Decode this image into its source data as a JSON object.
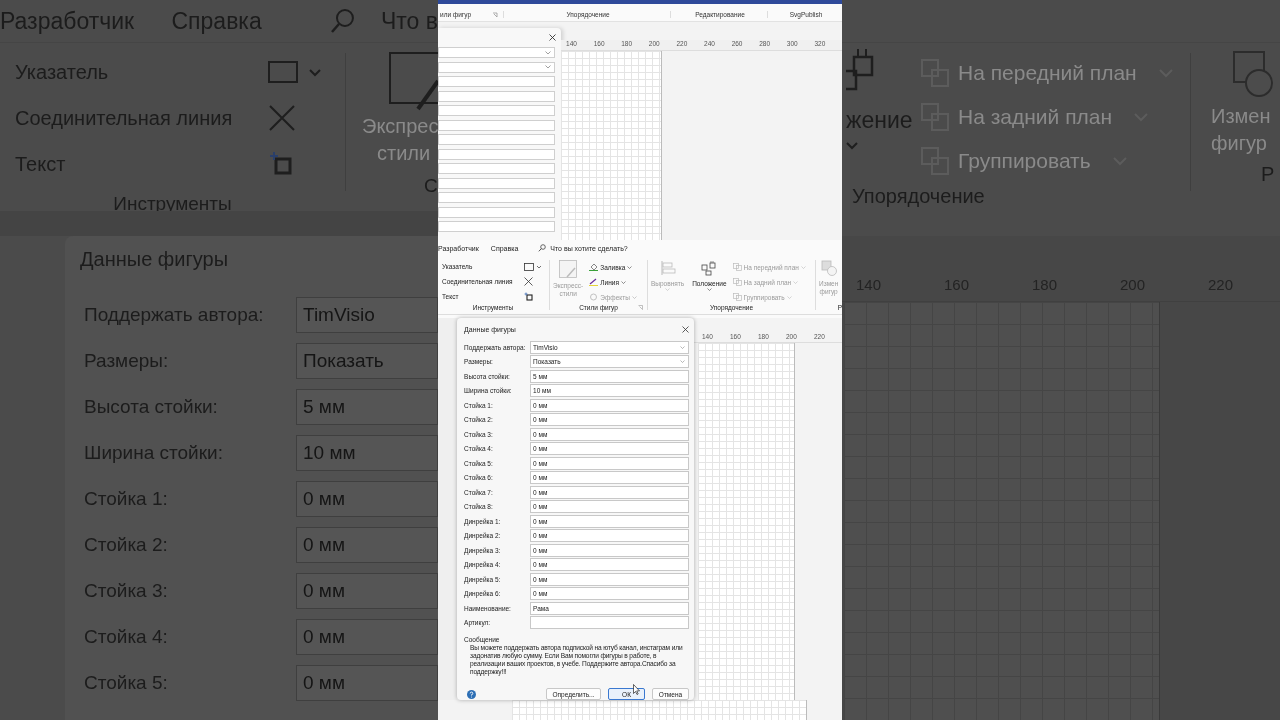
{
  "left_backdrop": {
    "tabs": [
      {
        "label": "Разработчик"
      },
      {
        "label": "Справка"
      }
    ],
    "search_text": "Что в",
    "tools": [
      {
        "label": "Указатель"
      },
      {
        "label": "Соединительная линия"
      },
      {
        "label": "Текст"
      }
    ],
    "tools_group": "Инструменты",
    "styles_button": {
      "lines": [
        "Экспрес",
        "стили"
      ],
      "disabled": true
    },
    "next_group": "С",
    "dialog": {
      "title": "Данные фигуры",
      "fields": [
        {
          "label": "Поддержать автора:",
          "value": "TimVisio"
        },
        {
          "label": "Размеры:",
          "value": "Показать"
        },
        {
          "label": "Высота стойки:",
          "value": "5 мм"
        },
        {
          "label": "Ширина стойки:",
          "value": "10 мм"
        },
        {
          "label": "Стойка 1:",
          "value": "0 мм"
        },
        {
          "label": "Стойка 2:",
          "value": "0 мм"
        },
        {
          "label": "Стойка 3:",
          "value": "0 мм"
        },
        {
          "label": "Стойка 4:",
          "value": "0 мм"
        },
        {
          "label": "Стойка 5:",
          "value": "0 мм"
        }
      ]
    }
  },
  "right_backdrop": {
    "position_label": "жение",
    "arrange": [
      {
        "label": "На передний план",
        "disabled": true
      },
      {
        "label": "На задний план",
        "disabled": true
      },
      {
        "label": "Группировать",
        "disabled": true
      }
    ],
    "group": "Упорядочение",
    "change_shape": {
      "lines": [
        "Измен",
        "фигур"
      ],
      "disabled": true
    },
    "next_group": "Р",
    "ruler": [
      "140",
      "160",
      "180",
      "200",
      "220"
    ]
  },
  "top_clip": {
    "group_labels": [
      "или фигур",
      "Упорядочение",
      "Редактирование",
      "SvgPublish"
    ],
    "ruler": [
      "140",
      "160",
      "180",
      "200",
      "220",
      "240",
      "260",
      "280",
      "300",
      "320"
    ],
    "panel_fields": [
      {
        "kind": "dropdown"
      },
      {
        "kind": "dropdown"
      },
      {
        "kind": "text"
      },
      {
        "kind": "text"
      },
      {
        "kind": "text"
      },
      {
        "kind": "text"
      },
      {
        "kind": "text"
      },
      {
        "kind": "text"
      },
      {
        "kind": "text"
      },
      {
        "kind": "text"
      },
      {
        "kind": "text"
      },
      {
        "kind": "text"
      },
      {
        "kind": "text"
      }
    ]
  },
  "ribbon": {
    "tabs": [
      {
        "label": "Разработчик"
      },
      {
        "label": "Справка"
      }
    ],
    "search_placeholder": "Что вы хотите сделать?",
    "tools": [
      {
        "label": "Указатель"
      },
      {
        "label": "Соединительная линия"
      },
      {
        "label": "Текст"
      }
    ],
    "tools_group": "Инструменты",
    "styles": {
      "express": {
        "lines": [
          "Экспресс-",
          "стили"
        ],
        "disabled": true
      },
      "items": [
        {
          "label": "Заливка",
          "disabled": false
        },
        {
          "label": "Линия",
          "disabled": false
        },
        {
          "label": "Эффекты",
          "disabled": true
        }
      ],
      "group": "Стили фигур"
    },
    "arrange": {
      "align": {
        "label": "Выровнять",
        "disabled": true
      },
      "position": {
        "label": "Положение",
        "disabled": false
      },
      "items": [
        {
          "label": "На передний план",
          "disabled": true
        },
        {
          "label": "На задний план",
          "disabled": true
        },
        {
          "label": "Группировать",
          "disabled": true
        }
      ],
      "group": "Упорядочение"
    },
    "change_shape": {
      "lines": [
        "Измен",
        "фигур"
      ],
      "disabled": true
    },
    "next_group": "Р"
  },
  "canvas_ruler": [
    "140",
    "160",
    "180",
    "200",
    "220"
  ],
  "dialog": {
    "title": "Данные фигуры",
    "fields": [
      {
        "label": "Поддержать автора:",
        "value": "TimVisio",
        "kind": "dropdown"
      },
      {
        "label": "Размеры:",
        "value": "Показать",
        "kind": "dropdown"
      },
      {
        "label": "Высота стойки:",
        "value": "5 мм",
        "kind": "text"
      },
      {
        "label": "Ширина стойки:",
        "value": "10 мм",
        "kind": "text"
      },
      {
        "label": "Стойка 1:",
        "value": "0 мм",
        "kind": "text"
      },
      {
        "label": "Стойка 2:",
        "value": "0 мм",
        "kind": "text"
      },
      {
        "label": "Стойка 3:",
        "value": "0 мм",
        "kind": "text"
      },
      {
        "label": "Стойка 4:",
        "value": "0 мм",
        "kind": "text"
      },
      {
        "label": "Стойка 5:",
        "value": "0 мм",
        "kind": "text"
      },
      {
        "label": "Стойка 6:",
        "value": "0 мм",
        "kind": "text"
      },
      {
        "label": "Стойка 7:",
        "value": "0 мм",
        "kind": "text"
      },
      {
        "label": "Стойка 8:",
        "value": "0 мм",
        "kind": "text"
      },
      {
        "label": "Динрейка 1:",
        "value": "0 мм",
        "kind": "text"
      },
      {
        "label": "Динрейка 2:",
        "value": "0 мм",
        "kind": "text"
      },
      {
        "label": "Динрейка 3:",
        "value": "0 мм",
        "kind": "text"
      },
      {
        "label": "Динрейка 4:",
        "value": "0 мм",
        "kind": "text"
      },
      {
        "label": "Динрейка 5:",
        "value": "0 мм",
        "kind": "text"
      },
      {
        "label": "Динрейка 6:",
        "value": "0 мм",
        "kind": "text"
      },
      {
        "label": "Наименование:",
        "value": "Рама",
        "kind": "text"
      },
      {
        "label": "Артикул:",
        "kind": "text"
      }
    ],
    "message_title": "Сообщение",
    "message": "Вы можете поддержать автора подпиской на ютуб канал, инстаграм или задонатив любую сумму. Если Вам помогли фигуры в работе, в реализации ваших проектов, в учебе. Поддержите автора.Спасибо за поддержку!!!",
    "buttons": [
      {
        "label": "Определить...",
        "default": false
      },
      {
        "label": "ОК",
        "default": true
      },
      {
        "label": "Отмена",
        "default": false
      }
    ]
  }
}
